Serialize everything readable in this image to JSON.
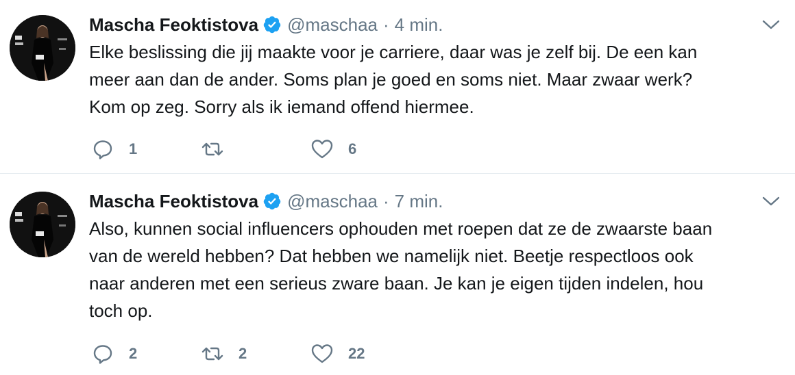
{
  "colors": {
    "verified": "#1da1f2",
    "secondary_text": "#657786",
    "primary_text": "#14171a",
    "divider": "#e6ecf0"
  },
  "tweets": [
    {
      "author_name": "Mascha Feoktistova",
      "handle": "@maschaa",
      "separator": "·",
      "time": "4 min.",
      "text_lines": [
        "Elke beslissing die jij maakte voor je carriere, daar was je zelf bij. De een kan",
        "meer aan dan de ander. Soms plan je goed en soms niet. Maar zwaar werk?",
        "Kom op zeg. Sorry als ik iemand offend hiermee."
      ],
      "reply_count": "1",
      "retweet_count": "",
      "like_count": "6",
      "icons": {
        "reply": "reply-icon",
        "retweet": "retweet-icon",
        "like": "heart-icon",
        "verified": "verified-badge-icon",
        "menu": "chevron-down-icon"
      }
    },
    {
      "author_name": "Mascha Feoktistova",
      "handle": "@maschaa",
      "separator": "·",
      "time": "7 min.",
      "text_lines": [
        "Also, kunnen social influencers ophouden met roepen dat ze de zwaarste baan",
        "van de wereld hebben? Dat hebben we namelijk niet. Beetje respectloos ook",
        "naar anderen met een serieus zware baan. Je kan je eigen tijden indelen, hou",
        "toch op."
      ],
      "reply_count": "2",
      "retweet_count": "2",
      "like_count": "22",
      "icons": {
        "reply": "reply-icon",
        "retweet": "retweet-icon",
        "like": "heart-icon",
        "verified": "verified-badge-icon",
        "menu": "chevron-down-icon"
      }
    }
  ]
}
